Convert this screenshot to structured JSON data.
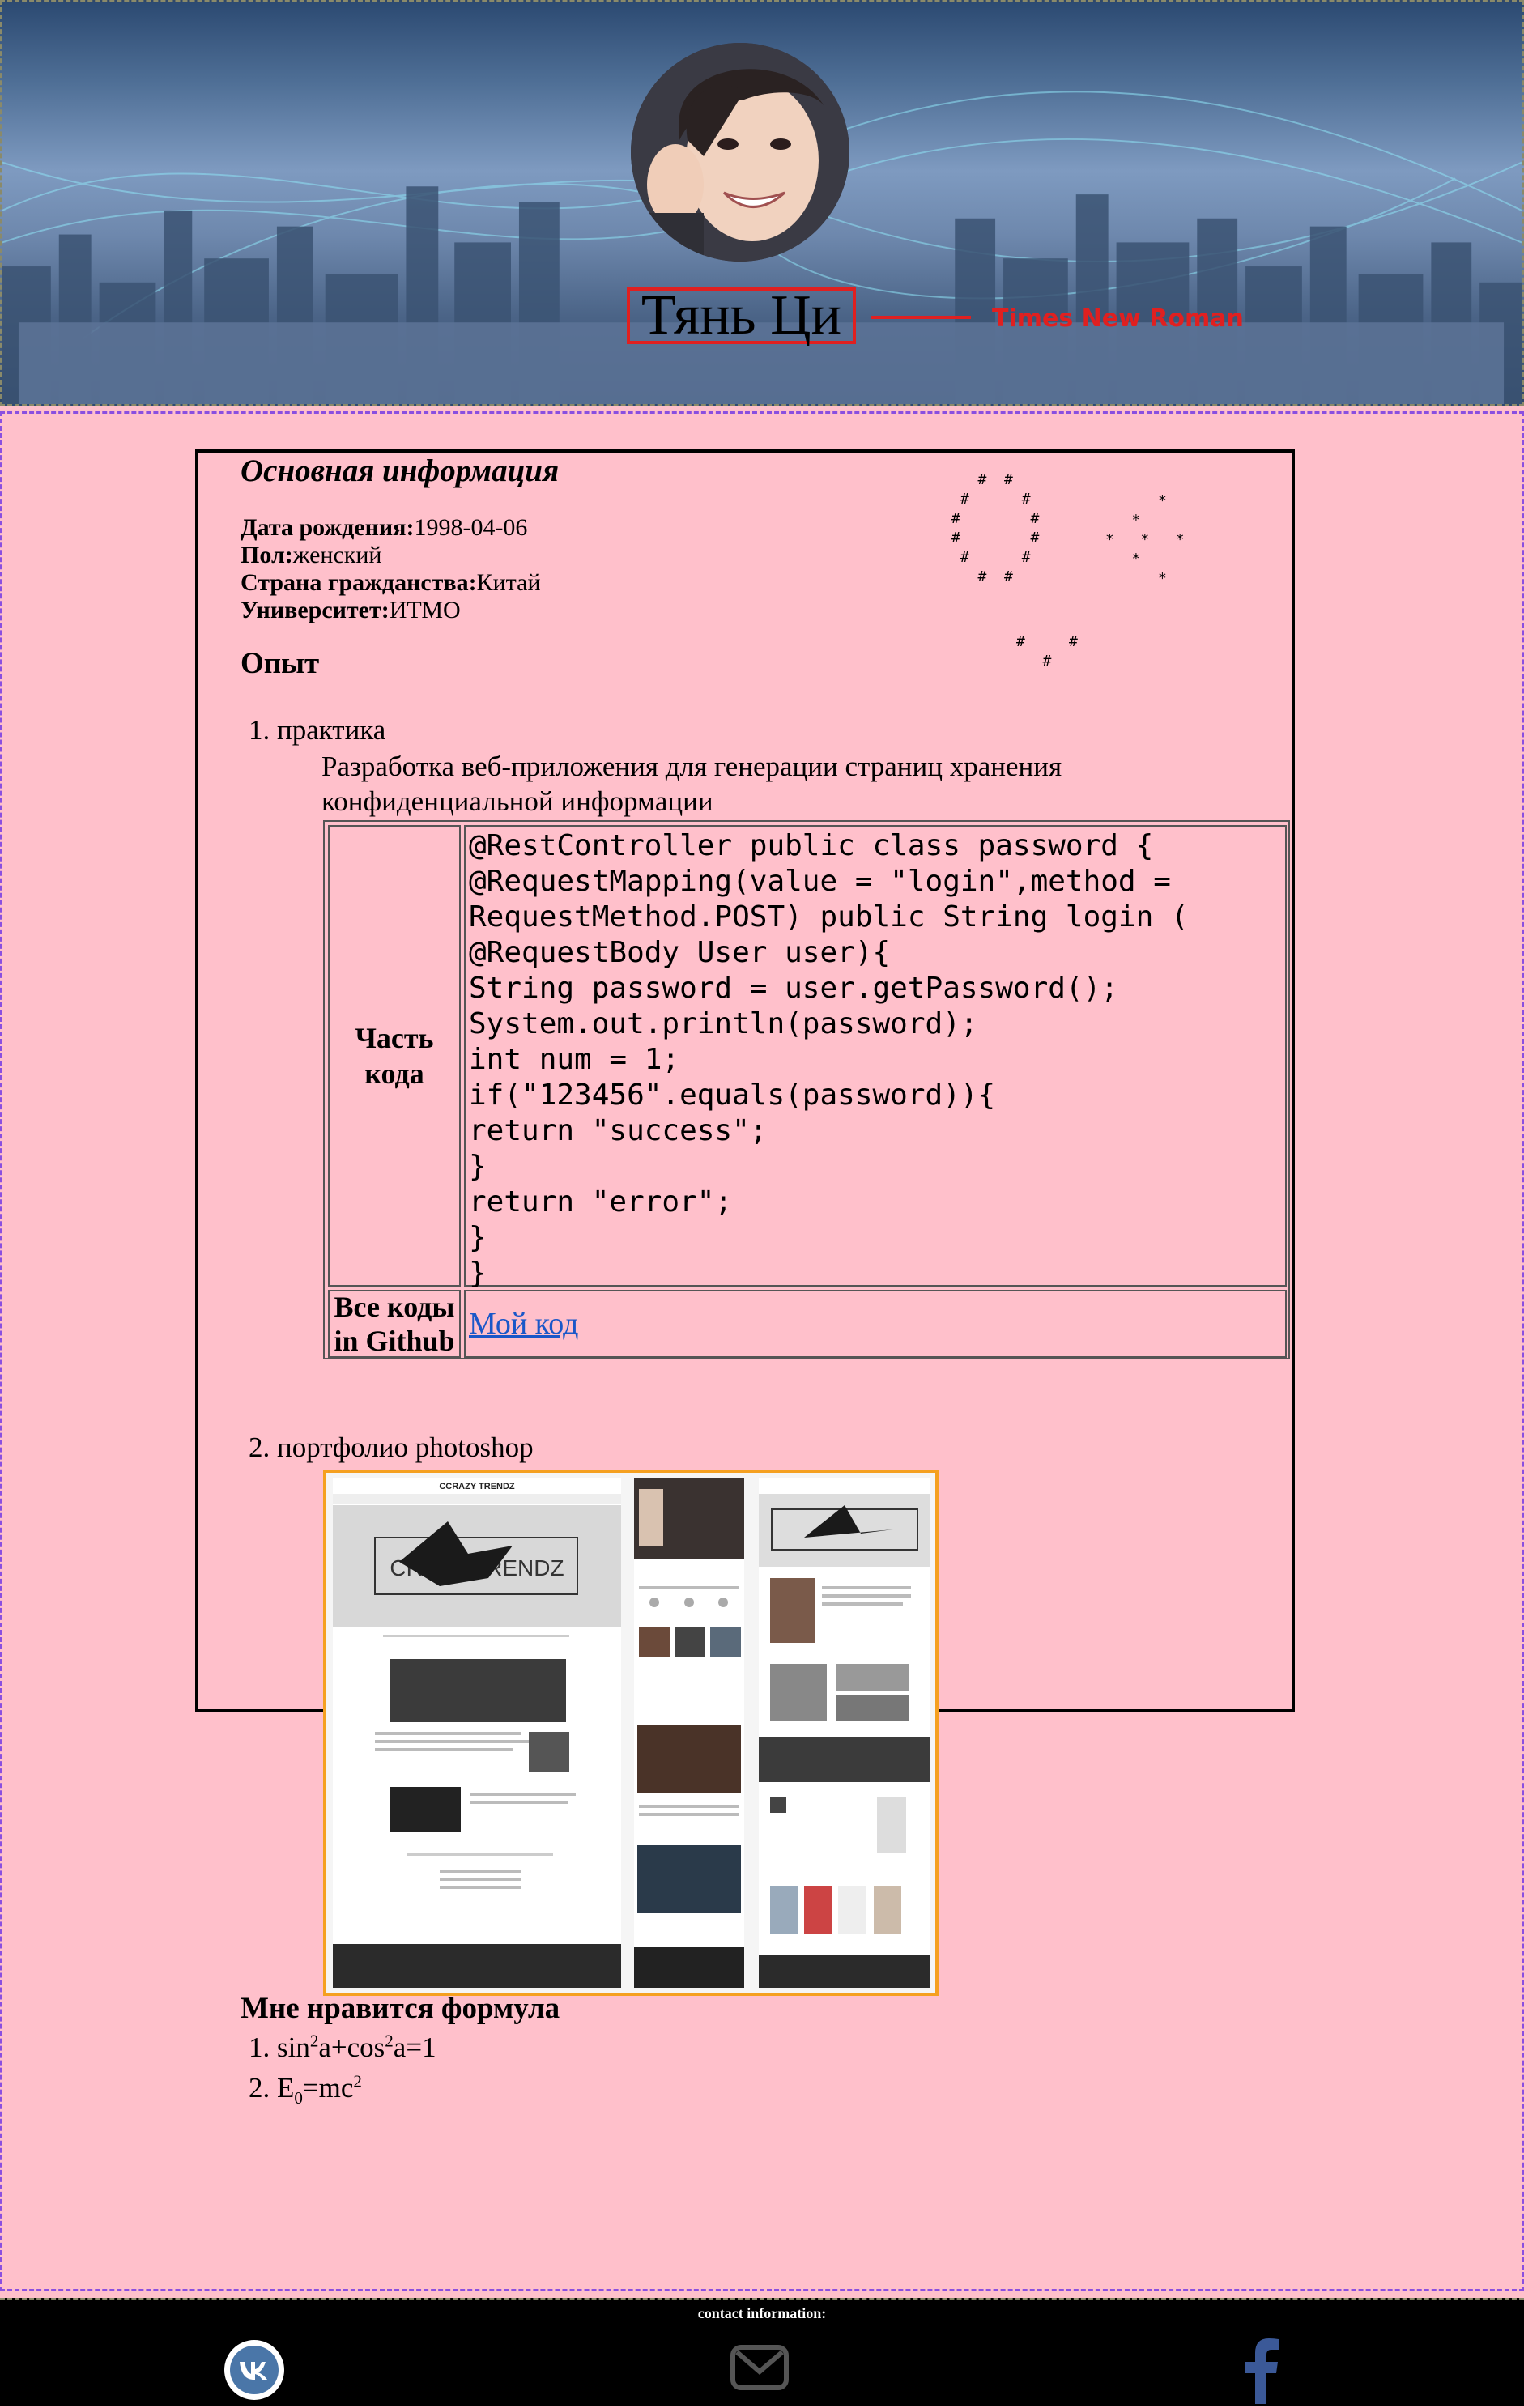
{
  "header": {
    "name": "Тянь Ци",
    "font_annotation": "Times New Roman",
    "annotation_color": "#e02020"
  },
  "info": {
    "title": "Основная информация",
    "fields": [
      {
        "label": "Дата рождения:",
        "value": "1998-04-06"
      },
      {
        "label": "Пол:",
        "value": "женский"
      },
      {
        "label": "Страна гражданства:",
        "value": "Китай"
      },
      {
        "label": "Университет:",
        "value": "ИТМО"
      }
    ]
  },
  "experience": {
    "title": "Опыт",
    "items": [
      {
        "num": "1.",
        "label": "практика"
      },
      {
        "num": "2.",
        "label": "портфолио photoshop"
      }
    ],
    "practice_description": "Разработка веб-приложения для генерации страниц хранения конфиденциальной информации",
    "code_label": "Часть кода",
    "code_lines": [
      "@RestController public class password {",
      "@RequestMapping(value = \"login\",method =",
      "RequestMethod.POST) public String login (",
      "@RequestBody User user){",
      "String password = user.getPassword();",
      "System.out.println(password);",
      "int num = 1;",
      "if(\"123456\".equals(password)){",
      "return \"success\";",
      "}",
      "return \"error\";",
      "}",
      "}"
    ],
    "github_label": "Все коды in Github",
    "github_link": "Мой код",
    "portfolio_brand": "CCRAZY TRENDZ",
    "portfolio_banner": "CRAZY TRENDZ"
  },
  "formulas": {
    "title": "Мне нравится формула",
    "f1": {
      "num": "1.",
      "a": "sin",
      "b": "a+cos",
      "c": "a=1",
      "exp": "2"
    },
    "f2": {
      "num": "2.",
      "a": "E",
      "sub": "0",
      "b": "=mc",
      "exp": "2"
    }
  },
  "footer": {
    "title": "contact information:",
    "icons": [
      "vk-icon",
      "mail-icon",
      "facebook-icon"
    ]
  },
  "colors": {
    "page_bg": "#ffc0cb",
    "link": "#1a57c8",
    "portfolio_border": "#f5a020"
  }
}
